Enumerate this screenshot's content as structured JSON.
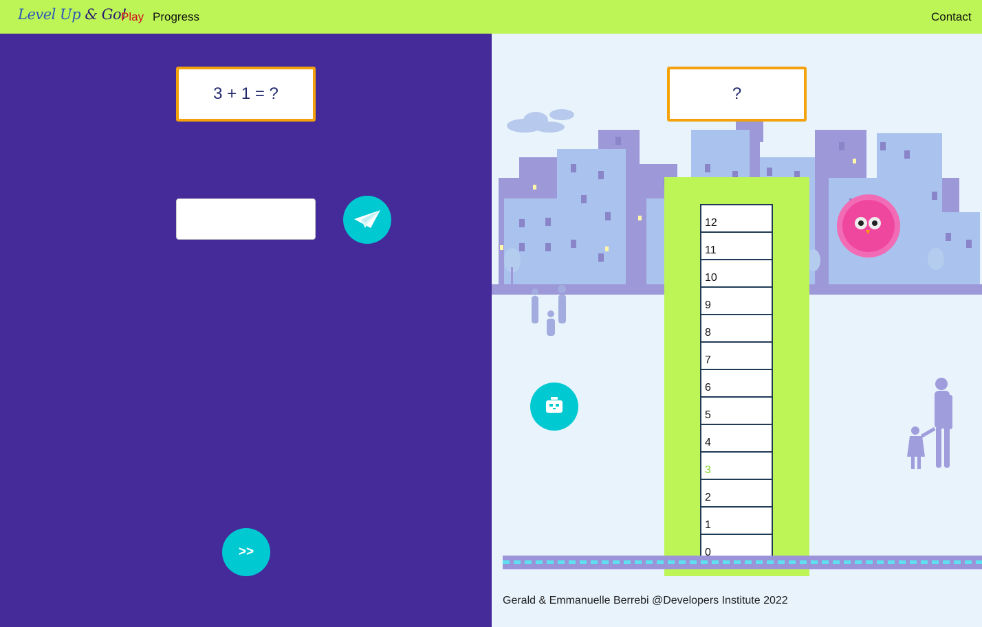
{
  "nav": {
    "brand_part1": "Level Up ",
    "brand_amp": "&",
    "brand_part2": " Go!",
    "play": "Play",
    "progress": "Progress",
    "contact": "Contact"
  },
  "game": {
    "question": "3 + 1 = ?",
    "answer_display": "?",
    "answer_value": "",
    "next_label": ">>"
  },
  "ladder": {
    "levels": [
      "12",
      "11",
      "10",
      "9",
      "8",
      "7",
      "6",
      "5",
      "4",
      "3",
      "2",
      "1",
      "0"
    ],
    "current_level": "3"
  },
  "footer": {
    "credit": "Gerald & Emmanuelle Berrebi @Developers Institute 2022"
  },
  "colors": {
    "nav_bg": "#bdf556",
    "left_bg": "#452b99",
    "accent_button": "#00c9d2",
    "box_border": "#f4a20c",
    "active_level": "#7ed321",
    "play_link": "#d2101f"
  },
  "icons": {
    "send": "paper-plane-icon",
    "robot": "robot-icon",
    "character": "pink-fluffy-monster"
  }
}
